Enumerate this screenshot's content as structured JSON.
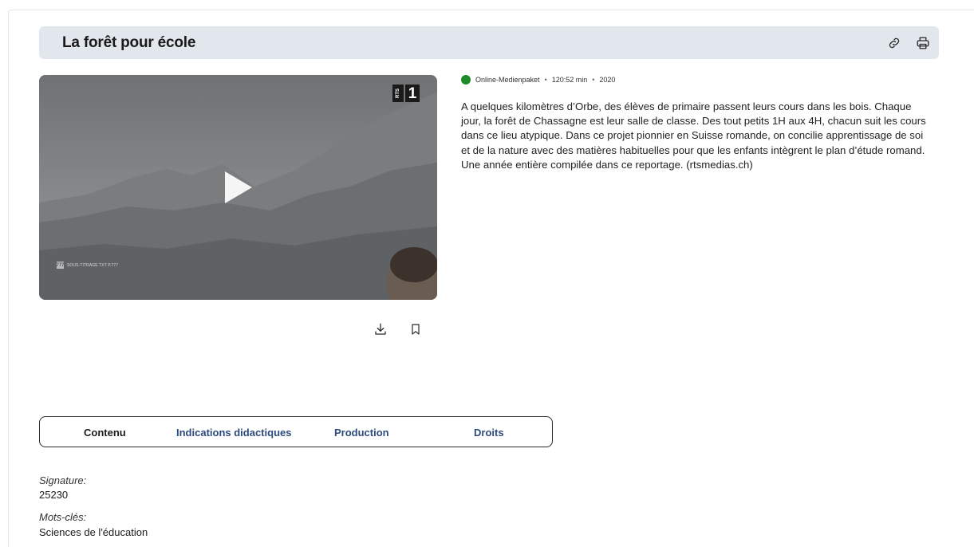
{
  "page": {
    "title": "La forêt pour école"
  },
  "video": {
    "channel_logo_rts": "RTS",
    "channel_logo_one": "1",
    "subtitle_badge": "777",
    "subtitle_text": "SOUS-TITRAGE TXT P.777"
  },
  "meta": {
    "status_color": "#1f8a2a",
    "type": "Online-Medienpaket",
    "duration": "120:52 min",
    "year": "2020",
    "separator": "•"
  },
  "description": "A quelques kilomètres d’Orbe, des élèves de primaire passent leurs cours dans les bois. Chaque jour, la forêt de Chassagne est leur salle de classe. Des tout petits 1H aux 4H, chacun suit les cours dans ce lieu atypique. Dans ce projet pionnier en Suisse romande, on concilie apprentissage de soi et de la nature avec des matières habituelles pour que les enfants intègrent le plan d’étude romand. Une année entière compilée dans ce reportage. (rtsmedias.ch)",
  "tabs": [
    {
      "label": "Contenu",
      "active": true
    },
    {
      "label": "Indications didactiques",
      "active": false
    },
    {
      "label": "Production",
      "active": false
    },
    {
      "label": "Droits",
      "active": false
    }
  ],
  "details": {
    "signature_label": "Signature:",
    "signature_value": "25230",
    "keywords_label": "Mots-clés:",
    "keywords_value": "Sciences de l'éducation"
  },
  "icons": {
    "link": "link-icon",
    "print": "print-icon",
    "download": "download-icon",
    "bookmark": "bookmark-icon",
    "play": "play-icon"
  }
}
